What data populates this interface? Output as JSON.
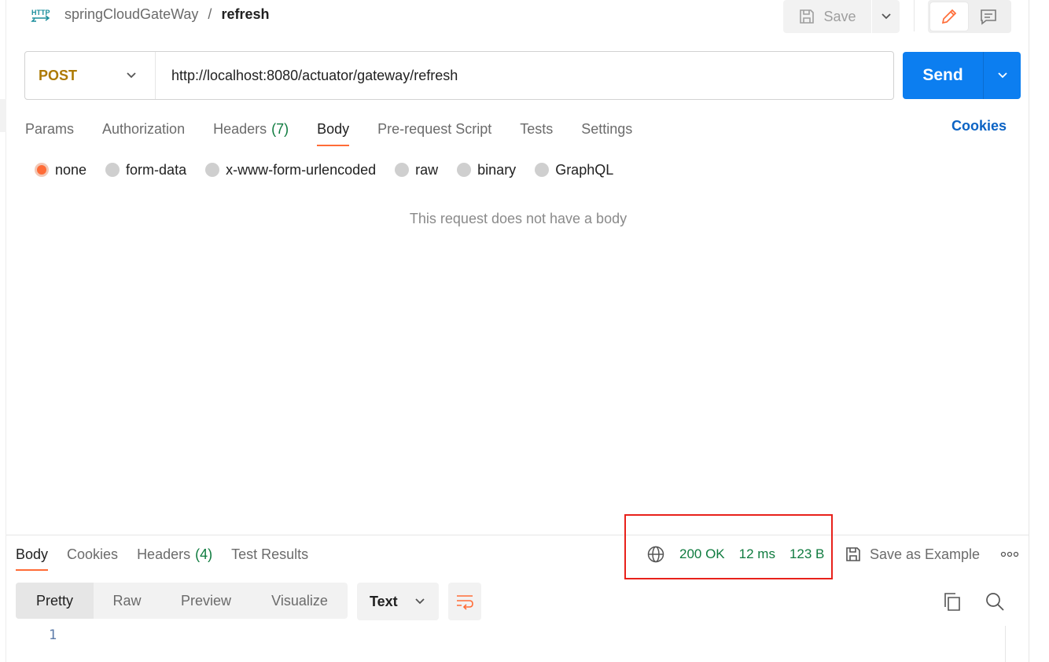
{
  "breadcrumb": {
    "icon_text": "HTTP",
    "parent": "springCloudGateWay",
    "separator": "/",
    "current": "refresh"
  },
  "toolbar": {
    "save_label": "Save",
    "modes": [
      "edit-icon",
      "comment-icon"
    ],
    "active_mode": "edit-icon"
  },
  "request": {
    "method": "POST",
    "url": "http://localhost:8080/actuator/gateway/refresh",
    "send_label": "Send"
  },
  "request_tabs": [
    {
      "label": "Params",
      "count": ""
    },
    {
      "label": "Authorization",
      "count": ""
    },
    {
      "label": "Headers",
      "count": "(7)"
    },
    {
      "label": "Body",
      "count": "",
      "active": true
    },
    {
      "label": "Pre-request Script",
      "count": ""
    },
    {
      "label": "Tests",
      "count": ""
    },
    {
      "label": "Settings",
      "count": ""
    }
  ],
  "cookies_link": "Cookies",
  "body_types": [
    {
      "label": "none",
      "checked": true
    },
    {
      "label": "form-data"
    },
    {
      "label": "x-www-form-urlencoded"
    },
    {
      "label": "raw"
    },
    {
      "label": "binary"
    },
    {
      "label": "GraphQL"
    }
  ],
  "empty_body_message": "This request does not have a body",
  "response": {
    "tabs": [
      {
        "label": "Body",
        "count": "",
        "active": true
      },
      {
        "label": "Cookies",
        "count": ""
      },
      {
        "label": "Headers",
        "count": "(4)"
      },
      {
        "label": "Test Results",
        "count": ""
      }
    ],
    "status": "200 OK",
    "time": "12 ms",
    "size": "123 B",
    "save_example_label": "Save as Example",
    "view_modes": [
      "Pretty",
      "Raw",
      "Preview",
      "Visualize"
    ],
    "active_view": "Pretty",
    "format": "Text",
    "line_numbers": [
      "1"
    ]
  },
  "colors": {
    "accent_orange": "#ff6c37",
    "send_blue": "#0c7ef0",
    "status_green": "#0f7b3f",
    "method_post": "#ad7a03",
    "highlight_red": "#e8211b"
  }
}
